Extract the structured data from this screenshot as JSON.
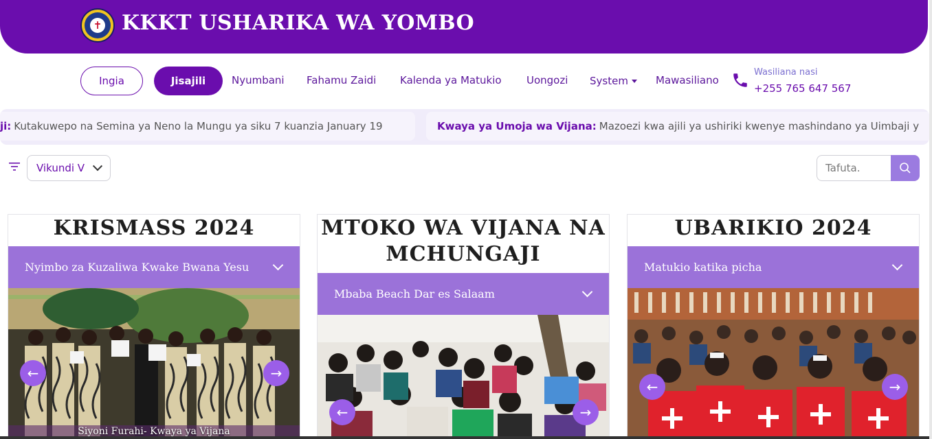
{
  "header": {
    "title": "KKKT USHARIKA WA YOMBO",
    "logo_icon": "church-seal-logo",
    "bg_color": "#6a0dad"
  },
  "nav": {
    "login_label": "Ingia",
    "register_label": "Jisajili",
    "links": [
      "Nyumbani",
      "Fahamu Zaidi",
      "Kalenda ya Matukio",
      "Uongozi",
      "System",
      "Mawasiliano"
    ],
    "contact_label": "Wasiliana nasi",
    "contact_phone": "+255 765 647 567"
  },
  "ticker": {
    "items": [
      {
        "prefix": "ji:",
        "text": "Kutakuwepo na Semina ya Neno la Mungu ya siku 7 kuanzia January 19"
      },
      {
        "prefix": "Kwaya ya Umoja wa Vijana:",
        "text": "Mazoezi kwa ajili ya ushiriki kwenye mashindano ya Uimbaji y"
      }
    ]
  },
  "filter": {
    "select_value": "Vikundi V",
    "search_placeholder": "Tafuta."
  },
  "cards": [
    {
      "title": "KRISMASS 2024",
      "subtitle": "Nyimbo za Kuzaliwa Kwake Bwana Yesu",
      "caption": "Siyoni Furahi- Kwaya ya Vijana",
      "prev_label": "←",
      "next_label": "→"
    },
    {
      "title_line1": "MTOKO WA VIJANA NA",
      "title_line2": "MCHUNGAJI",
      "subtitle": "Mbaba Beach Dar es Salaam",
      "prev_label": "←",
      "next_label": "→"
    },
    {
      "title": "UBARIKIO 2024",
      "subtitle": "Matukio katika picha",
      "prev_label": "←",
      "next_label": "→"
    }
  ],
  "colors": {
    "accent": "#6a0dad",
    "card_bar": "#9b72d9",
    "arrow": "#9b5ee8"
  }
}
